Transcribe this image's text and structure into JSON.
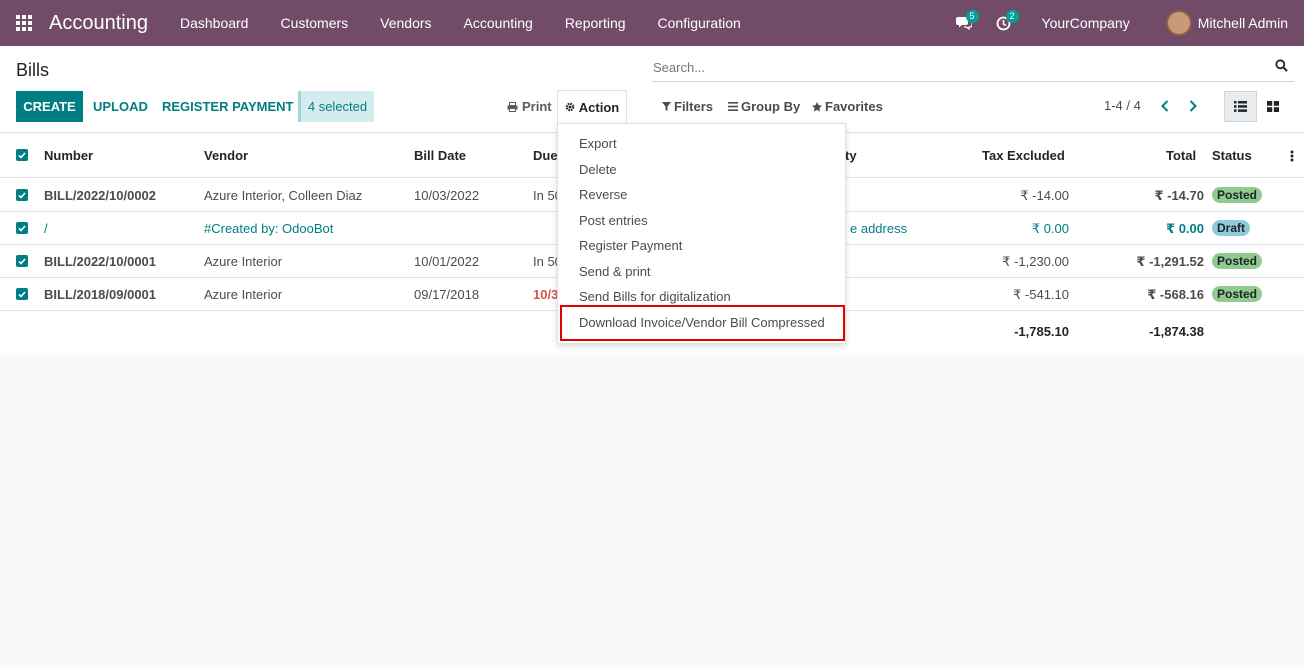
{
  "navbar": {
    "app_name": "Accounting",
    "menu": [
      "Dashboard",
      "Customers",
      "Vendors",
      "Accounting",
      "Reporting",
      "Configuration"
    ],
    "messages_count": "5",
    "activities_count": "2",
    "company": "YourCompany",
    "user": "Mitchell Admin"
  },
  "control": {
    "breadcrumb": "Bills",
    "create_label": "CREATE",
    "upload_label": "UPLOAD",
    "register_payment_label": "REGISTER PAYMENT",
    "selected_label": "4 selected",
    "print_label": "Print",
    "action_label": "Action",
    "search_placeholder": "Search...",
    "filters_label": "Filters",
    "groupby_label": "Group By",
    "favorites_label": "Favorites",
    "pager": "1-4 / 4"
  },
  "table": {
    "headers": {
      "number": "Number",
      "vendor": "Vendor",
      "bill_date": "Bill Date",
      "due": "Due",
      "activity_tail": "ty",
      "tax_excluded": "Tax Excluded",
      "total": "Total",
      "status": "Status"
    },
    "rows": [
      {
        "number": "BILL/2022/10/0002",
        "vendor": "Azure Interior, Colleen Diaz",
        "bill_date": "10/03/2022",
        "due": "In 50",
        "extra": "",
        "tax_excluded": "₹ -14.00",
        "total": "₹ -14.70",
        "status": "Posted"
      },
      {
        "number": "/",
        "vendor": "#Created by: OdooBot",
        "bill_date": "",
        "due": "",
        "extra": "e address",
        "tax_excluded": "₹ 0.00",
        "total": "₹ 0.00",
        "status": "Draft"
      },
      {
        "number": "BILL/2022/10/0001",
        "vendor": "Azure Interior",
        "bill_date": "10/01/2022",
        "due": "In 50",
        "extra": "",
        "tax_excluded": "₹ -1,230.00",
        "total": "₹ -1,291.52",
        "status": "Posted"
      },
      {
        "number": "BILL/2018/09/0001",
        "vendor": "Azure Interior",
        "bill_date": "09/17/2018",
        "due": "10/3",
        "extra": "",
        "tax_excluded": "₹ -541.10",
        "total": "₹ -568.16",
        "status": "Posted"
      }
    ],
    "totals": {
      "tax_excluded": "-1,785.10",
      "total": "-1,874.38"
    }
  },
  "action_menu": {
    "items": [
      "Export",
      "Delete",
      "Reverse",
      "Post entries",
      "Register Payment",
      "Send & print",
      "Send Bills for digitalization",
      "Download Invoice/Vendor Bill Compressed"
    ]
  },
  "colors": {
    "brand": "#714b67",
    "accent": "#017e84",
    "posted": "#8fcb8f",
    "draft": "#8fcbdc",
    "due_overdue": "#d9534f"
  }
}
